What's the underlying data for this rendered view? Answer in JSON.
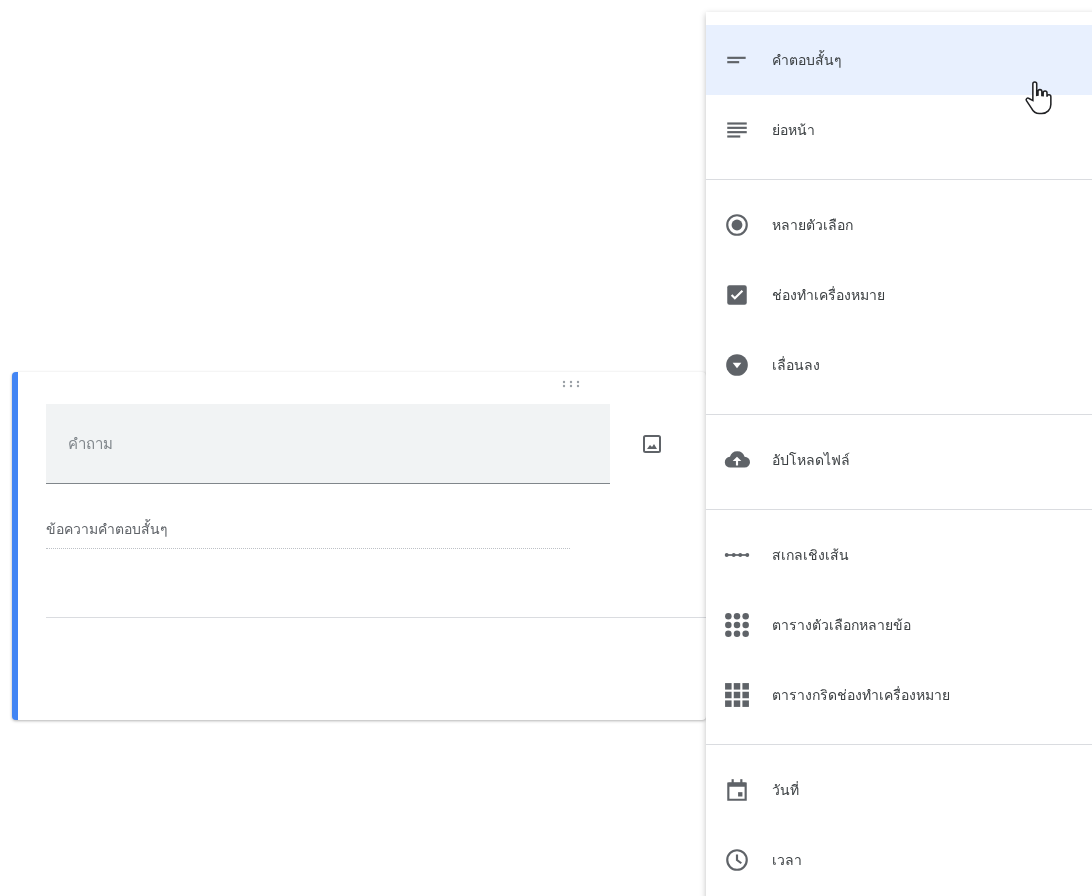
{
  "question_card": {
    "question": {
      "placeholder": "คำถาม"
    },
    "answer_hint": "ข้อความคำตอบสั้นๆ"
  },
  "type_menu": {
    "sections": [
      {
        "items": [
          {
            "label": "คำตอบสั้นๆ",
            "kind": "short",
            "selected": true
          },
          {
            "label": "ย่อหน้า",
            "kind": "paragraph",
            "selected": false
          }
        ]
      },
      {
        "items": [
          {
            "label": "หลายตัวเลือก",
            "kind": "radio",
            "selected": false
          },
          {
            "label": "ช่องทำเครื่องหมาย",
            "kind": "checkbox",
            "selected": false
          },
          {
            "label": "เลื่อนลง",
            "kind": "dropdown",
            "selected": false
          }
        ]
      },
      {
        "items": [
          {
            "label": "อัปโหลดไฟล์",
            "kind": "upload",
            "selected": false
          }
        ]
      },
      {
        "items": [
          {
            "label": "สเกลเชิงเส้น",
            "kind": "scale",
            "selected": false
          },
          {
            "label": "ตารางตัวเลือกหลายข้อ",
            "kind": "dotgrid",
            "selected": false
          },
          {
            "label": "ตารางกริดช่องทำเครื่องหมาย",
            "kind": "squaregrid",
            "selected": false
          }
        ]
      },
      {
        "items": [
          {
            "label": "วันที่",
            "kind": "date",
            "selected": false
          },
          {
            "label": "เวลา",
            "kind": "time",
            "selected": false
          }
        ]
      }
    ]
  }
}
